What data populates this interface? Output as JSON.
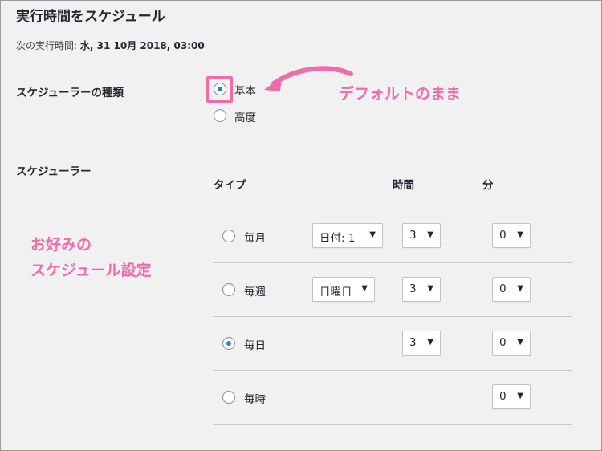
{
  "page": {
    "title": "実行時間をスケジュール"
  },
  "next_run": {
    "label": "次の実行時間:",
    "value": "水, 31 10月 2018, 03:00"
  },
  "scheduler_type": {
    "label": "スケジューラーの種類",
    "options": [
      {
        "label": "基本",
        "checked": true
      },
      {
        "label": "高度",
        "checked": false
      }
    ]
  },
  "scheduler": {
    "label": "スケジューラー",
    "headers": {
      "type": "タイプ",
      "hour": "時間",
      "minute": "分"
    },
    "rows": [
      {
        "label": "毎月",
        "checked": false,
        "day_select": "日付: 1",
        "hour": "3",
        "minute": "0"
      },
      {
        "label": "毎週",
        "checked": false,
        "day_select": "日曜日",
        "hour": "3",
        "minute": "0"
      },
      {
        "label": "毎日",
        "checked": true,
        "day_select": null,
        "hour": "3",
        "minute": "0"
      },
      {
        "label": "毎時",
        "checked": false,
        "day_select": null,
        "hour": null,
        "minute": "0"
      }
    ]
  },
  "annotations": {
    "default_note": "デフォルトのまま",
    "custom_line1": "お好みの",
    "custom_line2": "スケジュール設定"
  },
  "colors": {
    "accent": "#f06ba8",
    "radio_checked": "#1e8cbe"
  },
  "icons": {
    "dropdown": "▼"
  }
}
